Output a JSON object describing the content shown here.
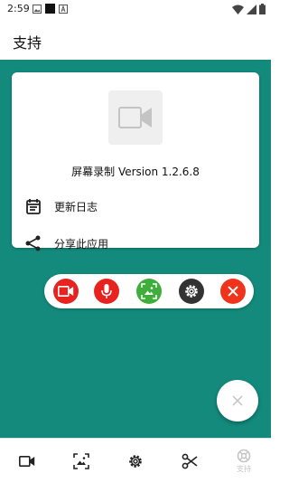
{
  "status_bar": {
    "time": "2:59",
    "left_icons": [
      "image-icon",
      "app-notification-icon",
      "a-letter-icon"
    ],
    "right_icons": [
      "wifi-icon",
      "signal-icon",
      "battery-icon"
    ]
  },
  "app_bar": {
    "title": "支持"
  },
  "colors": {
    "accent": "#138a7c",
    "record_red": "#e8231f",
    "screenshot_green": "#3fae3a",
    "settings_dark": "#333333",
    "close_orange_red": "#f0341c"
  },
  "card": {
    "logo_icon": "video-camera-icon",
    "version_text": "屏幕录制 Version 1.2.6.8",
    "items": [
      {
        "label": "更新日志",
        "icon": "calendar-icon"
      },
      {
        "label": "分享此应用",
        "icon": "share-icon"
      }
    ]
  },
  "floating_toolbar": {
    "buttons": [
      "record-video-icon",
      "microphone-icon",
      "screenshot-icon",
      "settings-gear-icon",
      "close-icon"
    ]
  },
  "fab": {
    "icon": "close-icon"
  },
  "bottom_nav": {
    "items": [
      {
        "icon": "video-camera-icon",
        "label": ""
      },
      {
        "icon": "screenshot-icon",
        "label": ""
      },
      {
        "icon": "gear-icon",
        "label": ""
      },
      {
        "icon": "scissors-icon",
        "label": ""
      },
      {
        "icon": "support-icon",
        "label": "支持",
        "active": true
      }
    ]
  }
}
